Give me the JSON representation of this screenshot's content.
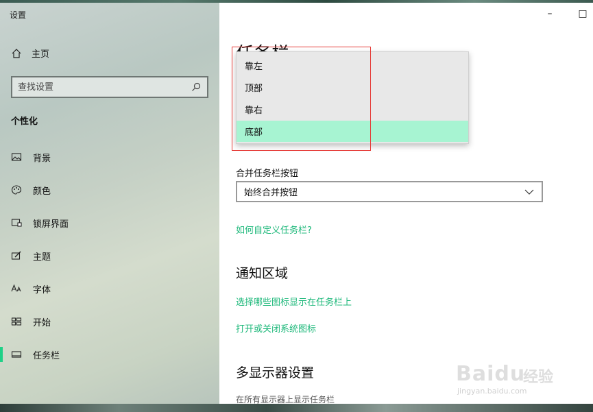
{
  "window": {
    "title": "设置",
    "minimize": "–",
    "maximize": "□"
  },
  "sidebar": {
    "home_label": "主页",
    "search_placeholder": "查找设置",
    "section": "个性化",
    "items": [
      {
        "label": "背景",
        "icon": "picture-icon"
      },
      {
        "label": "颜色",
        "icon": "palette-icon"
      },
      {
        "label": "锁屏界面",
        "icon": "lock-screen-icon"
      },
      {
        "label": "主题",
        "icon": "theme-brush-icon"
      },
      {
        "label": "字体",
        "icon": "font-icon"
      },
      {
        "label": "开始",
        "icon": "start-tiles-icon"
      },
      {
        "label": "任务栏",
        "icon": "taskbar-icon",
        "active": true
      }
    ]
  },
  "main": {
    "title": "任务栏",
    "combine_label": "合并任务栏按钮",
    "combine_value": "始终合并按钮",
    "customize_link": "如何自定义任务栏?",
    "notify_heading": "通知区域",
    "notify_link1": "选择哪些图标显示在任务栏上",
    "notify_link2": "打开或关闭系统图标",
    "multi_heading": "多显示器设置",
    "multi_sub": "在所有显示器上显示任务栏"
  },
  "dropdown": {
    "options": [
      "靠左",
      "顶部",
      "靠右",
      "底部"
    ],
    "selected": "底部"
  },
  "watermark": {
    "brand": "Baidu",
    "cn": "经验",
    "url": "jingyan.baidu.com"
  },
  "colors": {
    "accent": "#1db87a",
    "selected_bg": "#a7f4d2",
    "highlight_border": "#e53935"
  }
}
